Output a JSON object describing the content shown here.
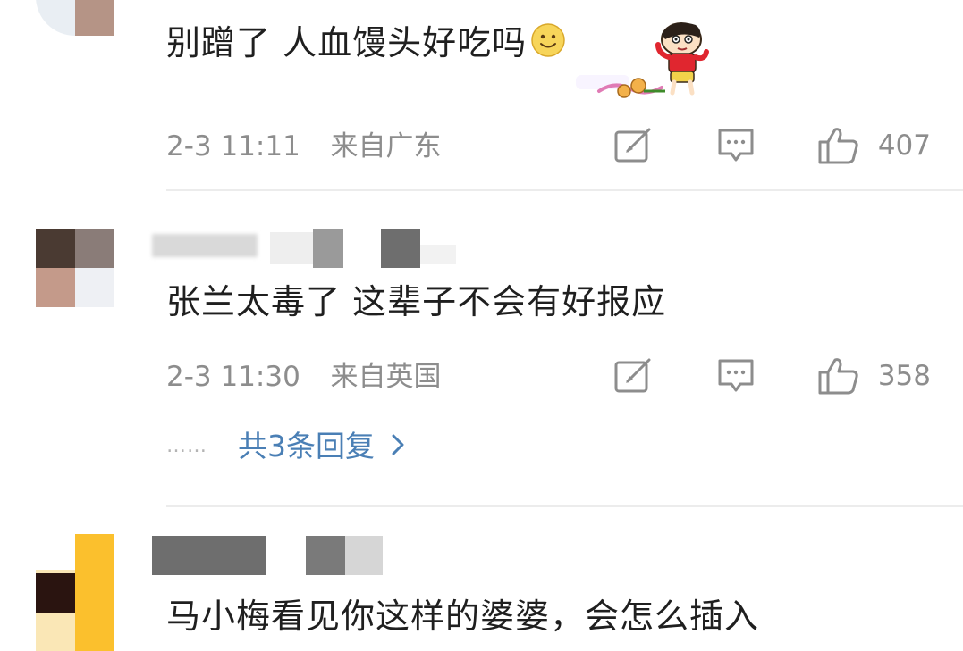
{
  "comments": [
    {
      "text": "别蹭了 人血馒头好吃吗",
      "time": "2-3 11:11",
      "location": "来自广东",
      "likes": "407"
    },
    {
      "text": "张兰太毒了 这辈子不会有好报应",
      "time": "2-3 11:30",
      "location": "来自英国",
      "likes": "358",
      "replies_label": "共3条回复",
      "replies_dots": "……"
    },
    {
      "text": "马小梅看见你这样的婆婆，会怎么插入"
    }
  ],
  "icons": {
    "repost": "repost-icon",
    "comment": "comment-icon",
    "like": "like-icon",
    "reply_chevron": "chevron-right-icon",
    "emoji": "smile-emoji-icon",
    "sticker": "crayon-shin-chan-sticker"
  },
  "colors": {
    "meta_text": "#8d8d8d",
    "reply_link": "#4a7fb5",
    "divider": "#ececec"
  }
}
